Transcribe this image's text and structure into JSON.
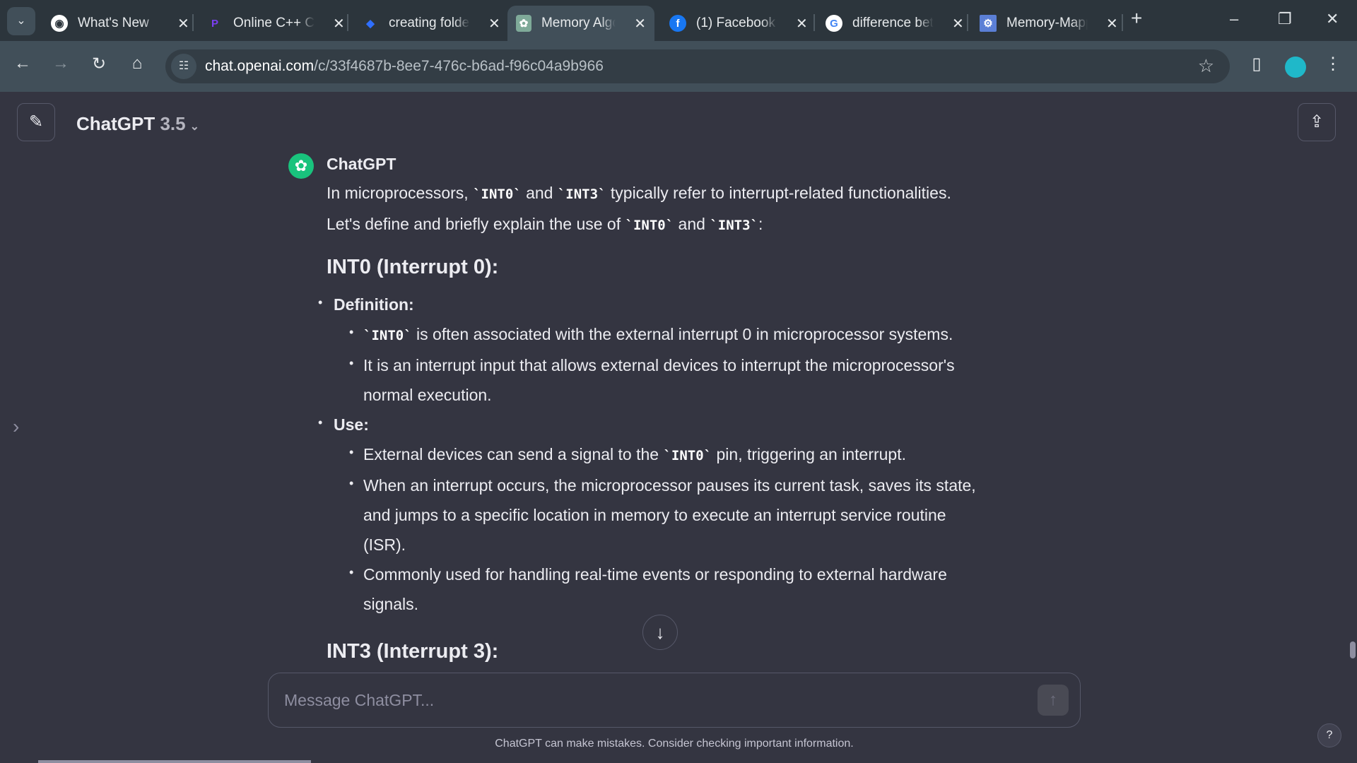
{
  "browser": {
    "tabs": [
      {
        "title": "What's New",
        "icon": "chrome-icon",
        "color": "#ffffff"
      },
      {
        "title": "Online C++ Compiler",
        "icon": "programiz-icon",
        "color": "#7b3ff2"
      },
      {
        "title": "creating folder",
        "icon": "diamond-icon",
        "color": "#2f6fff"
      },
      {
        "title": "Memory Algorithms",
        "icon": "chatgpt-icon",
        "color": "#7faa99"
      },
      {
        "title": "(1) Facebook",
        "icon": "facebook-icon",
        "color": "#1877f2"
      },
      {
        "title": "difference between",
        "icon": "google-icon",
        "color": "#ffffff"
      },
      {
        "title": "Memory-Mapped",
        "icon": "gear-site-icon",
        "color": "#5b7fd6"
      }
    ],
    "url_host": "chat.openai.com",
    "url_path": "/c/33f4687b-8ee7-476c-b6ad-f96c04a9b966"
  },
  "header": {
    "model_name": "ChatGPT",
    "model_version": "3.5"
  },
  "message": {
    "author": "ChatGPT",
    "intro": {
      "p1": "In microprocessors, ",
      "c1": "`INT0`",
      "p2": " and ",
      "c2": "`INT3`",
      "p3": " typically refer to interrupt-related functionalities. Let's define and briefly explain the use of ",
      "c3": "`INT0`",
      "p4": " and ",
      "c4": "`INT3`",
      "p5": ":"
    },
    "heading1": "INT0 (Interrupt 0):",
    "definition_label": "Definition:",
    "def1_code": "`INT0`",
    "def1_text": " is often associated with the external interrupt 0 in microprocessor systems.",
    "def2": "It is an interrupt input that allows external devices to interrupt the microprocessor's normal execution.",
    "use_label": "Use:",
    "use1_a": "External devices can send a signal to the ",
    "use1_code": "`INT0`",
    "use1_b": " pin, triggering an interrupt.",
    "use2": "When an interrupt occurs, the microprocessor pauses its current task, saves its state, and jumps to a specific location in memory to execute an interrupt service routine (ISR).",
    "use3": "Commonly used for handling real-time events or responding to external hardware signals.",
    "heading2": "INT3 (Interrupt 3):"
  },
  "composer": {
    "placeholder": "Message ChatGPT..."
  },
  "footer": {
    "disclaimer": "ChatGPT can make mistakes. Consider checking important information.",
    "help": "?"
  }
}
